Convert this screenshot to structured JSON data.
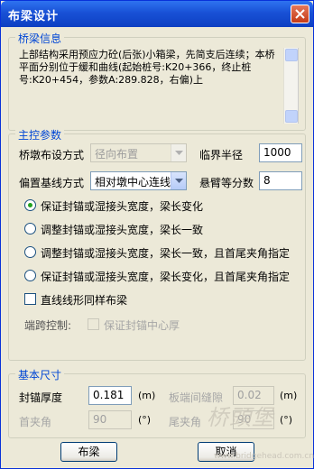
{
  "window": {
    "title": "布梁设计"
  },
  "bridge_info": {
    "group_title": "桥梁信息",
    "text": "上部结构采用预应力砼(后张)小箱梁，先简支后连续；本桥平面分别位于缓和曲线(起始桩号:K20+366，终止桩号:K20+454，参数A:289.828，右偏)上"
  },
  "main_params": {
    "group_title": "主控参数",
    "pier_layout_label": "桥墩布设方式",
    "pier_layout_value": "径向布置",
    "critical_radius_label": "临界半径",
    "critical_radius_value": "1000",
    "offset_baseline_label": "偏置基线方式",
    "offset_baseline_value": "相对墩中心连线",
    "cantilever_label": "悬臂等分数",
    "cantilever_value": "8",
    "radio_options": [
      {
        "label": "保证封锚或湿接头宽度，梁长变化",
        "selected": true
      },
      {
        "label": "调整封锚或湿接头宽度，梁长一致",
        "selected": false
      },
      {
        "label": "调整封锚或湿接头宽度，梁长一致，且首尾夹角指定",
        "selected": false
      },
      {
        "label": "保证封锚或湿接头宽度，梁长变化，且首尾夹角指定",
        "selected": false
      }
    ],
    "straight_same_label": "直线线形同样布梁",
    "end_span_label": "端跨控制:",
    "anchor_center_label": "保证封锚中心厚"
  },
  "basic_size": {
    "group_title": "基本尺寸",
    "anchor_thickness_label": "封锚厚度",
    "anchor_thickness_value": "0.181",
    "unit_m_1": "(m)",
    "end_gap_label": "板端间缝隙",
    "end_gap_value": "0.02",
    "unit_m_2": "(m)",
    "first_angle_label": "首夹角",
    "first_angle_value": "90",
    "unit_deg_1": "(°)",
    "last_angle_label": "尾夹角",
    "last_angle_value": "90",
    "unit_deg_2": "(°)"
  },
  "buttons": {
    "layout": "布梁",
    "cancel": "取消"
  },
  "watermark": {
    "text": "桥頭堡",
    "sub": "www.bridgehead.com.cn"
  },
  "colors": {
    "title_bar": "#1851d6",
    "group_title": "#0046d5",
    "dialog_bg": "#ece9d8",
    "radio_dot": "#21a121"
  }
}
